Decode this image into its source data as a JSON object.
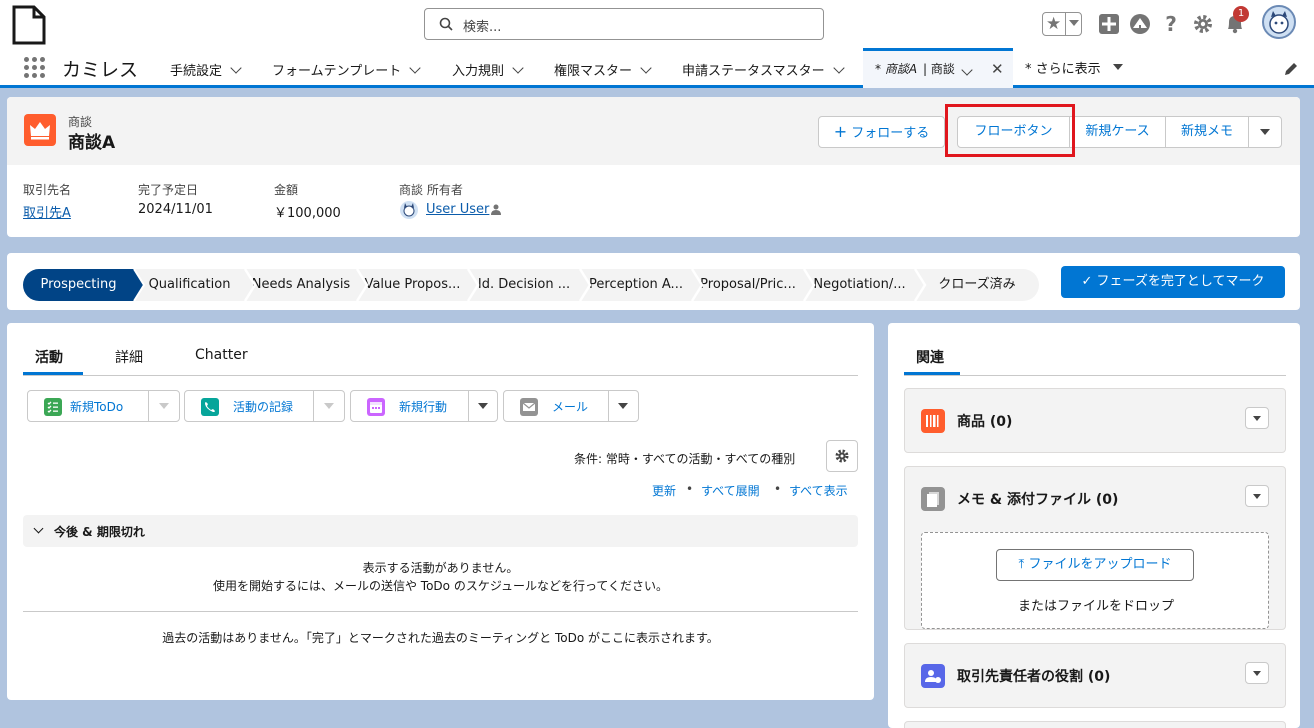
{
  "header": {
    "search_placeholder": "検索...",
    "notification_count": "1"
  },
  "nav": {
    "app_name": "カミレス",
    "items": [
      "手続設定",
      "フォームテンプレート",
      "入力規則",
      "権限マスター",
      "申請ステータスマスター"
    ],
    "active_tab": {
      "prefix": "* 商談A",
      "suffix": "| 商談"
    },
    "more": "* さらに表示"
  },
  "record": {
    "object_label": "商談",
    "name": "商談A",
    "buttons": {
      "follow": "フォローする",
      "flow": "フローボタン",
      "new_case": "新規ケース",
      "new_memo": "新規メモ"
    },
    "fields": [
      {
        "label": "取引先名",
        "value": "取引先A"
      },
      {
        "label": "完了予定日",
        "value": "2024/11/01"
      },
      {
        "label": "金額",
        "value": "￥100,000"
      },
      {
        "label": "商談 所有者",
        "value": "User User"
      }
    ]
  },
  "path": {
    "stages": [
      "Prospecting",
      "Qualification",
      "Needs Analysis",
      "Value Propos...",
      "Id. Decision ...",
      "Perception A...",
      "Proposal/Pric...",
      "Negotiation/...",
      "クローズ済み"
    ],
    "mark_button": "フェーズを完了としてマーク"
  },
  "activity": {
    "tabs": [
      "活動",
      "詳細",
      "Chatter"
    ],
    "buttons": [
      "新規ToDo",
      "活動の記録",
      "新規行動",
      "メール"
    ],
    "filter": "条件: 常時・すべての活動・すべての種別",
    "links": [
      "更新",
      "すべて展開",
      "すべて表示"
    ],
    "section": "今後 & 期限切れ",
    "empty_line1": "表示する活動がありません。",
    "empty_line2": "使用を開始するには、メールの送信や ToDo のスケジュールなどを行ってください。",
    "past_empty": "過去の活動はありません。「完了」とマークされた過去のミーティングと ToDo がここに表示されます。"
  },
  "related": {
    "tab": "関連",
    "sections": [
      "商品 (0)",
      "メモ & 添付ファイル (0)",
      "取引先責任者の役割 (0)"
    ],
    "upload_button": "ファイルをアップロード",
    "drop_text": "またはファイルをドロップ"
  },
  "colors": {
    "brand": "#0176d3",
    "active_stage": "#014486",
    "opportunity_icon": "#ff5d2d",
    "highlight": "#e0161d"
  }
}
